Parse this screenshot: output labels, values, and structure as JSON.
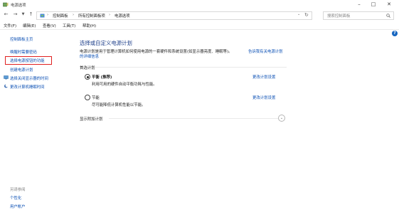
{
  "window": {
    "title": "电源选项"
  },
  "address": {
    "segments": [
      "控制面板",
      "所有控制面板项",
      "电源选项"
    ],
    "search_placeholder": "搜索控制面板"
  },
  "menu": [
    "文件(F)",
    "编辑(E)",
    "查看(V)",
    "工具(T)",
    "帮助(H)"
  ],
  "sidebar": {
    "items": [
      "控制面板主页",
      "唤醒时需要密码",
      "选择电源按钮的功能",
      "创建电源计划",
      "选择关闭显示器的时间",
      "更改计算机睡眠时间"
    ],
    "see_also_heading": "另请参阅",
    "see_also": [
      "个性化",
      "用户帐户"
    ]
  },
  "main": {
    "heading": "选择或自定义电源计划",
    "desc_part1": "电源计划是用于管理计算机如何使用电源的一套硬件和系统设置(如显示器亮度、睡眠等)。",
    "desc_link": "告诉我有关电源计划",
    "desc_link2": "的详细信息",
    "group_label": "首选计划",
    "plans": [
      {
        "name": "平衡 (推荐)",
        "desc": "利用可用的硬件自动平衡功耗与性能。",
        "settings": "更改计划设置",
        "selected": true
      },
      {
        "name": "节能",
        "desc": "尽可能降低计算机性能以节能。",
        "settings": "更改计划设置",
        "selected": false
      }
    ],
    "extra_label": "显示附加计划"
  },
  "colors": {
    "link": "#0a4fb4",
    "highlight_border": "#e02020",
    "help": "#1565c0"
  }
}
